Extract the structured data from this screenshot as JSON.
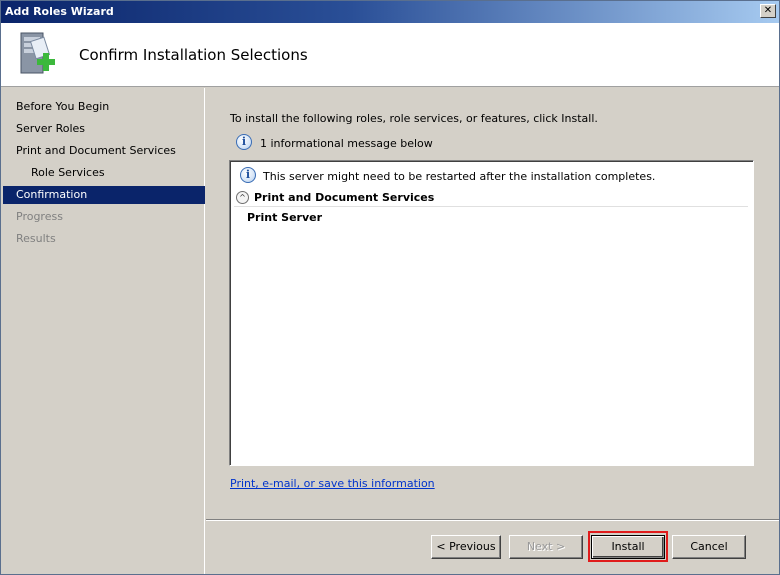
{
  "window": {
    "title": "Add Roles Wizard",
    "close_glyph": "✕"
  },
  "header": {
    "title": "Confirm Installation Selections",
    "icon": "server-roles-add-icon"
  },
  "nav": {
    "items": [
      {
        "label": "Before You Begin",
        "state": "normal"
      },
      {
        "label": "Server Roles",
        "state": "normal"
      },
      {
        "label": "Print and Document Services",
        "state": "normal"
      },
      {
        "label": "Role Services",
        "state": "normal",
        "sub": true
      },
      {
        "label": "Confirmation",
        "state": "active"
      },
      {
        "label": "Progress",
        "state": "disabled"
      },
      {
        "label": "Results",
        "state": "disabled"
      }
    ]
  },
  "content": {
    "intro": "To install the following roles, role services, or features, click Install.",
    "info_summary": "1 informational message below",
    "info_glyph": "i",
    "details": {
      "message": "This server might need to be restarted after the installation completes.",
      "section_title": "Print and Document Services",
      "collapse_glyph": "^",
      "items": [
        "Print Server"
      ]
    },
    "link": "Print, e-mail, or save this information"
  },
  "footer": {
    "previous_label": "< Previous",
    "next_label": "Next >",
    "install_label": "Install",
    "cancel_label": "Cancel"
  },
  "colors": {
    "accent": "#0a246a",
    "highlight": "#e01b1b",
    "link": "#0033cc"
  }
}
